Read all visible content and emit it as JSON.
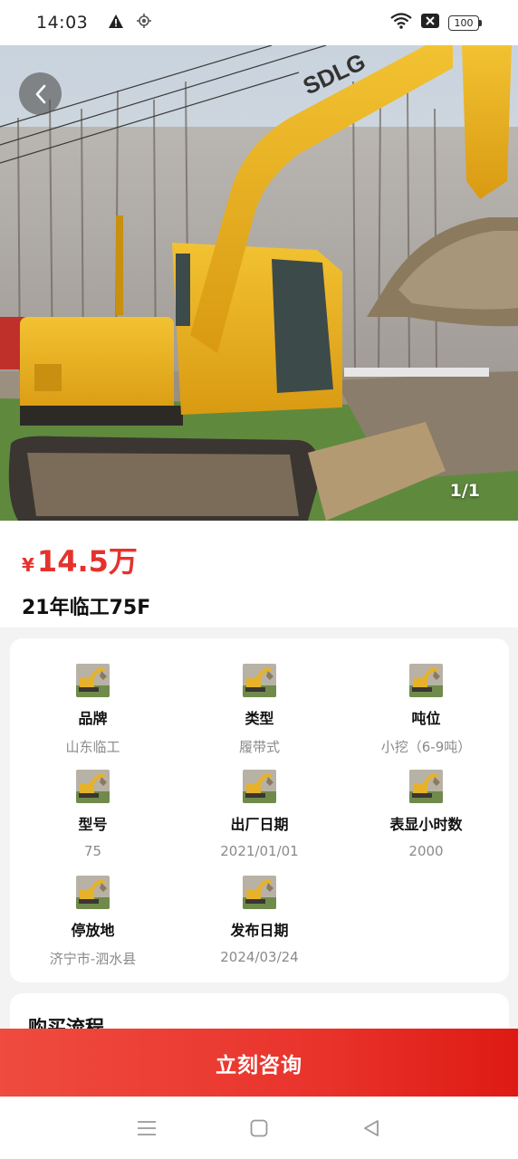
{
  "status_bar": {
    "time": "14:03",
    "battery": "100",
    "icons": [
      "warning-icon",
      "location-icon",
      "wifi-icon",
      "sim-off-icon",
      "battery-icon"
    ]
  },
  "hero": {
    "image": "yellow SDLG excavator",
    "counter": "1/1",
    "back_icon": "chevron-left-icon"
  },
  "listing": {
    "price_symbol": "¥",
    "price_value": "14.5万",
    "title": "21年临工75F",
    "price_color": "#e5322d"
  },
  "specs": [
    {
      "label": "品牌",
      "value": "山东临工"
    },
    {
      "label": "类型",
      "value": "履带式"
    },
    {
      "label": "吨位",
      "value": "小挖（6-9吨）"
    },
    {
      "label": "型号",
      "value": "75"
    },
    {
      "label": "出厂日期",
      "value": "2021/01/01"
    },
    {
      "label": "表显小时数",
      "value": "2000"
    },
    {
      "label": "停放地",
      "value": "济宁市-泗水县"
    },
    {
      "label": "发布日期",
      "value": "2024/03/24"
    }
  ],
  "process": {
    "title": "购买流程"
  },
  "cta": {
    "label": "立刻咨询",
    "color": "#e9342c"
  },
  "nav_bar": {
    "icons": [
      "menu-icon",
      "home-icon",
      "back-icon"
    ]
  }
}
